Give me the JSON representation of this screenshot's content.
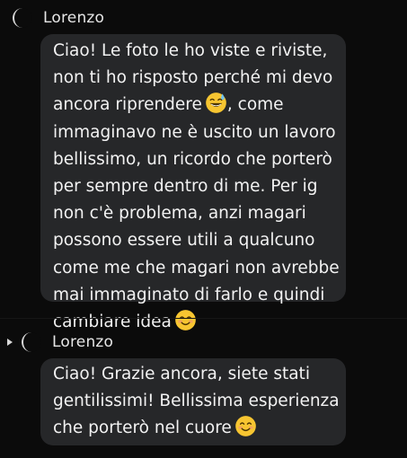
{
  "messages": [
    {
      "sender": "Lorenzo",
      "lines": [
        "Ciao! Le foto le ho viste e riviste,",
        "non ti ho risposto perché mi devo",
        "ancora riprendere",
        "immaginavo ne è uscito un lavoro",
        "bellissimo, un ricordo che porterò",
        "per sempre dentro di me. Per ig",
        "non c'è problema, anzi magari",
        "possono essere utili a qualcuno",
        "come me che magari non avrebbe",
        "mai immaginato di farlo e quindi",
        "cambiare idea"
      ],
      "line3_after_emoji": ",  come",
      "emoji_1": "grinning-sweat-emoji",
      "emoji_2": "smiling-blush-emoji"
    },
    {
      "sender": "Lorenzo",
      "lines": [
        "Ciao! Grazie ancora, siete stati",
        "gentilissimi!  Bellissima esperienza",
        "che porterò nel cuore"
      ],
      "emoji": "smiling-blush-emoji"
    }
  ],
  "colors": {
    "background": "#0b0b0b",
    "bubble": "#262729",
    "text": "#f2f2f2",
    "emoji_face": "#f7c531"
  }
}
